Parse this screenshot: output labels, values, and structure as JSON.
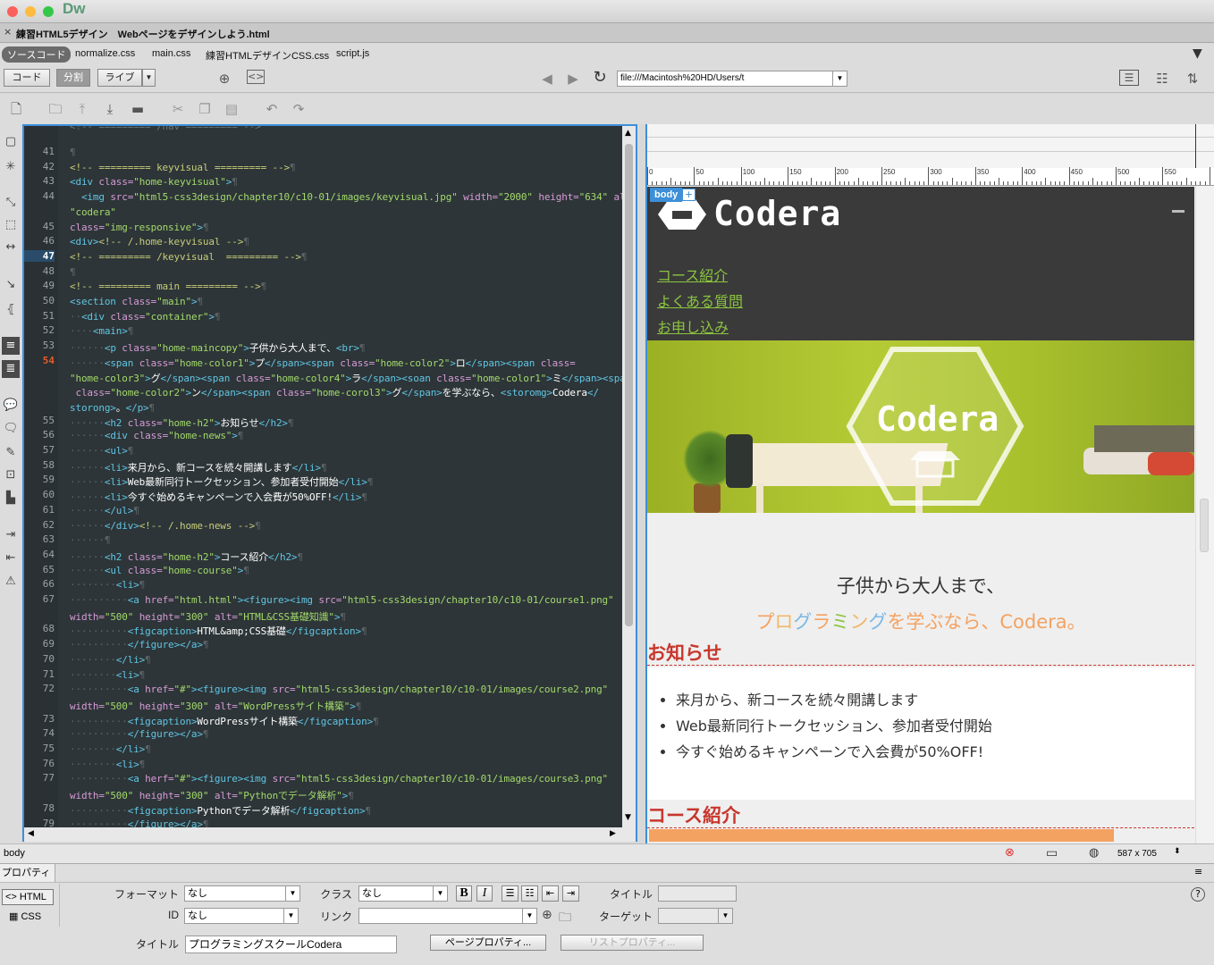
{
  "app": {
    "logo": "Dw"
  },
  "document_tab": {
    "close": "×",
    "filename": "練習HTML5デザイン　Webページをデザインしよう.html"
  },
  "related_files": [
    "ソースコード",
    "normalize.css",
    "main.css",
    "練習HTMLデザインCSS.css",
    "script.js"
  ],
  "view_buttons": {
    "code": "コード",
    "split": "分割",
    "live": "ライブ"
  },
  "address": {
    "url": "file:///Macintosh%20HD/Users/t"
  },
  "code": {
    "lines": [
      {
        "n": "41",
        "html": "<span class='dot'>¶</span>"
      },
      {
        "n": "42",
        "html": "<span class='c'>&lt;!-- ========= keyvisual ========= --&gt;</span><span class='dot'>¶</span>"
      },
      {
        "n": "43",
        "html": "<span class='t'>&lt;div</span> <span class='a'>class=</span><span class='v'>\"home-keyvisual\"</span><span class='t'>&gt;</span><span class='dot'>¶</span>"
      },
      {
        "n": "44",
        "html": "  <span class='t'>&lt;img</span> <span class='a'>src=</span><span class='v'>\"html5-css3design/chapter10/c10-01/images/keyvisual.jpg\"</span> <span class='a'>width=</span><span class='v'>\"2000\"</span> <span class='a'>height=</span><span class='v'>\"634\"</span> <span class='a'>alt=</span>"
      },
      {
        "n": "",
        "html": "<span class='v'>\"codera\"</span>"
      },
      {
        "n": "45",
        "html": "<span class='a'>class=</span><span class='v'>\"img-responsive\"</span><span class='t'>&gt;</span><span class='dot'>¶</span>"
      },
      {
        "n": "46",
        "html": "<span class='t'>&lt;div&gt;</span><span class='c'>&lt;!-- /.home-keyvisual --&gt;</span><span class='dot'>¶</span>"
      },
      {
        "n": "47",
        "cur": true,
        "html": "<span class='c'>&lt;!-- ========= /keyvisual  ========= --&gt;</span><span class='dot'>¶</span>"
      },
      {
        "n": "48",
        "html": "<span class='dot'>¶</span>"
      },
      {
        "n": "49",
        "html": "<span class='c'>&lt;!-- ========= main ========= --&gt;</span><span class='dot'>¶</span>"
      },
      {
        "n": "50",
        "html": "<span class='t'>&lt;section</span> <span class='a'>class=</span><span class='v'>\"main\"</span><span class='t'>&gt;</span><span class='dot'>¶</span>"
      },
      {
        "n": "51",
        "html": "<span class='dot'>··</span><span class='t'>&lt;div</span> <span class='a'>class=</span><span class='v'>\"container\"</span><span class='t'>&gt;</span><span class='dot'>¶</span>"
      },
      {
        "n": "52",
        "html": "<span class='dot'>····</span><span class='t'>&lt;main&gt;</span><span class='dot'>¶</span>"
      },
      {
        "n": "53",
        "html": "<span class='dot'>······</span><span class='t'>&lt;p</span> <span class='a'>class=</span><span class='v'>\"home-maincopy\"</span><span class='t'>&gt;</span><span class='x'>子供から大人まで、</span><span class='t'>&lt;br&gt;</span><span class='dot'>¶</span>"
      },
      {
        "n": "54",
        "mark": true,
        "html": "<span class='dot'>······</span><span class='t'>&lt;span</span> <span class='a'>class=</span><span class='v'>\"home-color1\"</span><span class='t'>&gt;</span><span class='x'>プ</span><span class='t'>&lt;/span&gt;&lt;span</span> <span class='a'>class=</span><span class='v'>\"home-color2\"</span><span class='t'>&gt;</span><span class='x'>ロ</span><span class='t'>&lt;/span&gt;&lt;span</span> <span class='a'>class=</span>"
      },
      {
        "n": "",
        "html": "<span class='v'>\"home-color3\"</span><span class='t'>&gt;</span><span class='x'>グ</span><span class='t'>&lt;/span&gt;&lt;span</span> <span class='a'>class=</span><span class='v'>\"home-color4\"</span><span class='t'>&gt;</span><span class='x'>ラ</span><span class='t'>&lt;/span&gt;&lt;soan</span> <span class='a'>class=</span><span class='v'>\"home-color1\"</span><span class='t'>&gt;</span><span class='x'>ミ</span><span class='t'>&lt;/span&gt;&lt;span</span>"
      },
      {
        "n": "",
        "html": " <span class='a'>class=</span><span class='v'>\"home-color2\"</span><span class='t'>&gt;</span><span class='x'>ン</span><span class='t'>&lt;/span&gt;&lt;span</span> <span class='a'>class=</span><span class='v'>\"home-corol3\"</span><span class='t'>&gt;</span><span class='x'>グ</span><span class='t'>&lt;/span&gt;</span><span class='x'>を学ぶなら、</span><span class='t'>&lt;storomg&gt;</span><span class='x'>Codera</span><span class='t'>&lt;/</span>"
      },
      {
        "n": "",
        "html": "<span class='t'>storong&gt;</span><span class='x'>。</span><span class='t'>&lt;/p&gt;</span><span class='dot'>¶</span>"
      },
      {
        "n": "55",
        "html": "<span class='dot'>······</span><span class='t'>&lt;h2</span> <span class='a'>class=</span><span class='v'>\"home-h2\"</span><span class='t'>&gt;</span><span class='x'>お知らせ</span><span class='t'>&lt;/h2&gt;</span><span class='dot'>¶</span>"
      },
      {
        "n": "56",
        "html": "<span class='dot'>······</span><span class='t'>&lt;div</span> <span class='a'>class=</span><span class='v'>\"home-news\"</span><span class='t'>&gt;</span><span class='dot'>¶</span>"
      },
      {
        "n": "57",
        "html": "<span class='dot'>······</span><span class='t'>&lt;ul&gt;</span><span class='dot'>¶</span>"
      },
      {
        "n": "58",
        "html": "<span class='dot'>······</span><span class='t'>&lt;li&gt;</span><span class='x'>来月から、新コースを続々開講します</span><span class='t'>&lt;/li&gt;</span><span class='dot'>¶</span>"
      },
      {
        "n": "59",
        "html": "<span class='dot'>······</span><span class='t'>&lt;li&gt;</span><span class='x'>Web最新同行トークセッション、参加者受付開始</span><span class='t'>&lt;/li&gt;</span><span class='dot'>¶</span>"
      },
      {
        "n": "60",
        "html": "<span class='dot'>······</span><span class='t'>&lt;li&gt;</span><span class='x'>今すぐ始めるキャンペーンで入会費が50%OFF!</span><span class='t'>&lt;/li&gt;</span><span class='dot'>¶</span>"
      },
      {
        "n": "61",
        "html": "<span class='dot'>······</span><span class='t'>&lt;/ul&gt;</span><span class='dot'>¶</span>"
      },
      {
        "n": "62",
        "html": "<span class='dot'>······</span><span class='t'>&lt;/div&gt;</span><span class='c'>&lt;!-- /.home-news --&gt;</span><span class='dot'>¶</span>"
      },
      {
        "n": "63",
        "html": "<span class='dot'>······¶</span>"
      },
      {
        "n": "64",
        "html": "<span class='dot'>······</span><span class='t'>&lt;h2</span> <span class='a'>class=</span><span class='v'>\"home-h2\"</span><span class='t'>&gt;</span><span class='x'>コース紹介</span><span class='t'>&lt;/h2&gt;</span><span class='dot'>¶</span>"
      },
      {
        "n": "65",
        "html": "<span class='dot'>······</span><span class='t'>&lt;ul</span> <span class='a'>class=</span><span class='v'>\"home-course\"</span><span class='t'>&gt;</span><span class='dot'>¶</span>"
      },
      {
        "n": "66",
        "html": "<span class='dot'>········</span><span class='t'>&lt;li&gt;</span><span class='dot'>¶</span>"
      },
      {
        "n": "67",
        "html": "<span class='dot'>··········</span><span class='t'>&lt;a</span> <span class='a'>href=</span><span class='v'>\"html.html\"</span><span class='t'>&gt;&lt;figure&gt;&lt;img</span> <span class='a'>src=</span><span class='v'>\"html5-css3design/chapter10/c10-01/course1.png\"</span>"
      },
      {
        "n": "",
        "html": "<span class='a'>width=</span><span class='v'>\"500\"</span> <span class='a'>height=</span><span class='v'>\"300\"</span> <span class='a'>alt=</span><span class='v'>\"HTML&amp;CSS基礎知識\"</span><span class='t'>&gt;</span><span class='dot'>¶</span>"
      },
      {
        "n": "68",
        "html": "<span class='dot'>··········</span><span class='t'>&lt;figcaption&gt;</span><span class='x'>HTML&amp;amp;CSS基礎</span><span class='t'>&lt;/figcaption&gt;</span><span class='dot'>¶</span>"
      },
      {
        "n": "69",
        "html": "<span class='dot'>··········</span><span class='t'>&lt;/figure&gt;&lt;/a&gt;</span><span class='dot'>¶</span>"
      },
      {
        "n": "70",
        "html": "<span class='dot'>········</span><span class='t'>&lt;/li&gt;</span><span class='dot'>¶</span>"
      },
      {
        "n": "71",
        "html": "<span class='dot'>········</span><span class='t'>&lt;li&gt;</span><span class='dot'>¶</span>"
      },
      {
        "n": "72",
        "html": "<span class='dot'>··········</span><span class='t'>&lt;a</span> <span class='a'>href=</span><span class='v'>\"#\"</span><span class='t'>&gt;&lt;figure&gt;&lt;img</span> <span class='a'>src=</span><span class='v'>\"html5-css3design/chapter10/c10-01/images/course2.png\"</span>"
      },
      {
        "n": "",
        "html": "<span class='a'>width=</span><span class='v'>\"500\"</span> <span class='a'>height=</span><span class='v'>\"300\"</span> <span class='a'>alt=</span><span class='v'>\"WordPressサイト構築\"</span><span class='t'>&gt;</span><span class='dot'>¶</span>"
      },
      {
        "n": "73",
        "html": "<span class='dot'>··········</span><span class='t'>&lt;figcaption&gt;</span><span class='x'>WordPressサイト構築</span><span class='t'>&lt;/figcaption&gt;</span><span class='dot'>¶</span>"
      },
      {
        "n": "74",
        "html": "<span class='dot'>··········</span><span class='t'>&lt;/figure&gt;&lt;/a&gt;</span><span class='dot'>¶</span>"
      },
      {
        "n": "75",
        "html": "<span class='dot'>········</span><span class='t'>&lt;/li&gt;</span><span class='dot'>¶</span>"
      },
      {
        "n": "76",
        "html": "<span class='dot'>········</span><span class='t'>&lt;li&gt;</span><span class='dot'>¶</span>"
      },
      {
        "n": "77",
        "html": "<span class='dot'>··········</span><span class='t'>&lt;a</span> <span class='a'>herf=</span><span class='v'>\"#\"</span><span class='t'>&gt;&lt;figure&gt;&lt;img</span> <span class='a'>src=</span><span class='v'>\"html5-css3design/chapter10/c10-01/images/course3.png\"</span>"
      },
      {
        "n": "",
        "html": "<span class='a'>width=</span><span class='v'>\"500\"</span> <span class='a'>height=</span><span class='v'>\"300\"</span> <span class='a'>alt=</span><span class='v'>\"Pythonでデータ解析\"</span><span class='t'>&gt;</span><span class='dot'>¶</span>"
      },
      {
        "n": "78",
        "html": "<span class='dot'>··········</span><span class='t'>&lt;figcaption&gt;</span><span class='x'>Pythonでデータ解析</span><span class='t'>&lt;/figcaption&gt;</span><span class='dot'>¶</span>"
      },
      {
        "n": "79",
        "html": "<span class='dot'>··········</span><span class='t'>&lt;/figure&gt;&lt;/a&gt;</span><span class='dot'>¶</span>"
      }
    ]
  },
  "ruler": {
    "ticks": [
      "0",
      "50",
      "100",
      "150",
      "200",
      "250",
      "300",
      "350",
      "400",
      "450",
      "500",
      "550"
    ]
  },
  "preview": {
    "body_tag": "body",
    "plus": "+",
    "logo_text": "Codera",
    "nav": [
      "コース紹介",
      "よくある質問",
      "お申し込み"
    ],
    "hero_text": "Codera",
    "maincopy_line1": "子供から大人まで、",
    "maincopy_line2_chars": [
      {
        "ch": "プ",
        "color": "#f4a261"
      },
      {
        "ch": "ロ",
        "color": "#f0b86a"
      },
      {
        "ch": "グ",
        "color": "#7cb8e4"
      },
      {
        "ch": "ラ",
        "color": "#f4a261"
      },
      {
        "ch": "ミ",
        "color": "#8bc53f"
      },
      {
        "ch": "ン",
        "color": "#f0b86a"
      },
      {
        "ch": "グ",
        "color": "#7cb8e4"
      },
      {
        "ch": "を学ぶなら、Codera。",
        "color": "#f4a261"
      }
    ],
    "news_heading": "お知らせ",
    "news_items": [
      "来月から、新コースを続々開講します",
      "Web最新同行トークセッション、参加者受付開始",
      "今すぐ始めるキャンペーンで入会費が50%OFF!"
    ],
    "course_heading": "コース紹介",
    "accent": "#c8372d"
  },
  "status": {
    "tag": "body",
    "size": "587 x 705"
  },
  "properties": {
    "panel_title": "プロパティ",
    "html_tab": "HTML",
    "css_tab": "CSS",
    "format_label": "フォーマット",
    "format_value": "なし",
    "class_label": "クラス",
    "class_value": "なし",
    "title_label": "タイトル",
    "id_label": "ID",
    "id_value": "なし",
    "link_label": "リンク",
    "target_label": "ターゲット",
    "doc_title_label": "タイトル",
    "doc_title_value": "プログラミングスクールCodera",
    "page_props_button": "ページプロパティ...",
    "list_props_button": "リストプロパティ..."
  }
}
